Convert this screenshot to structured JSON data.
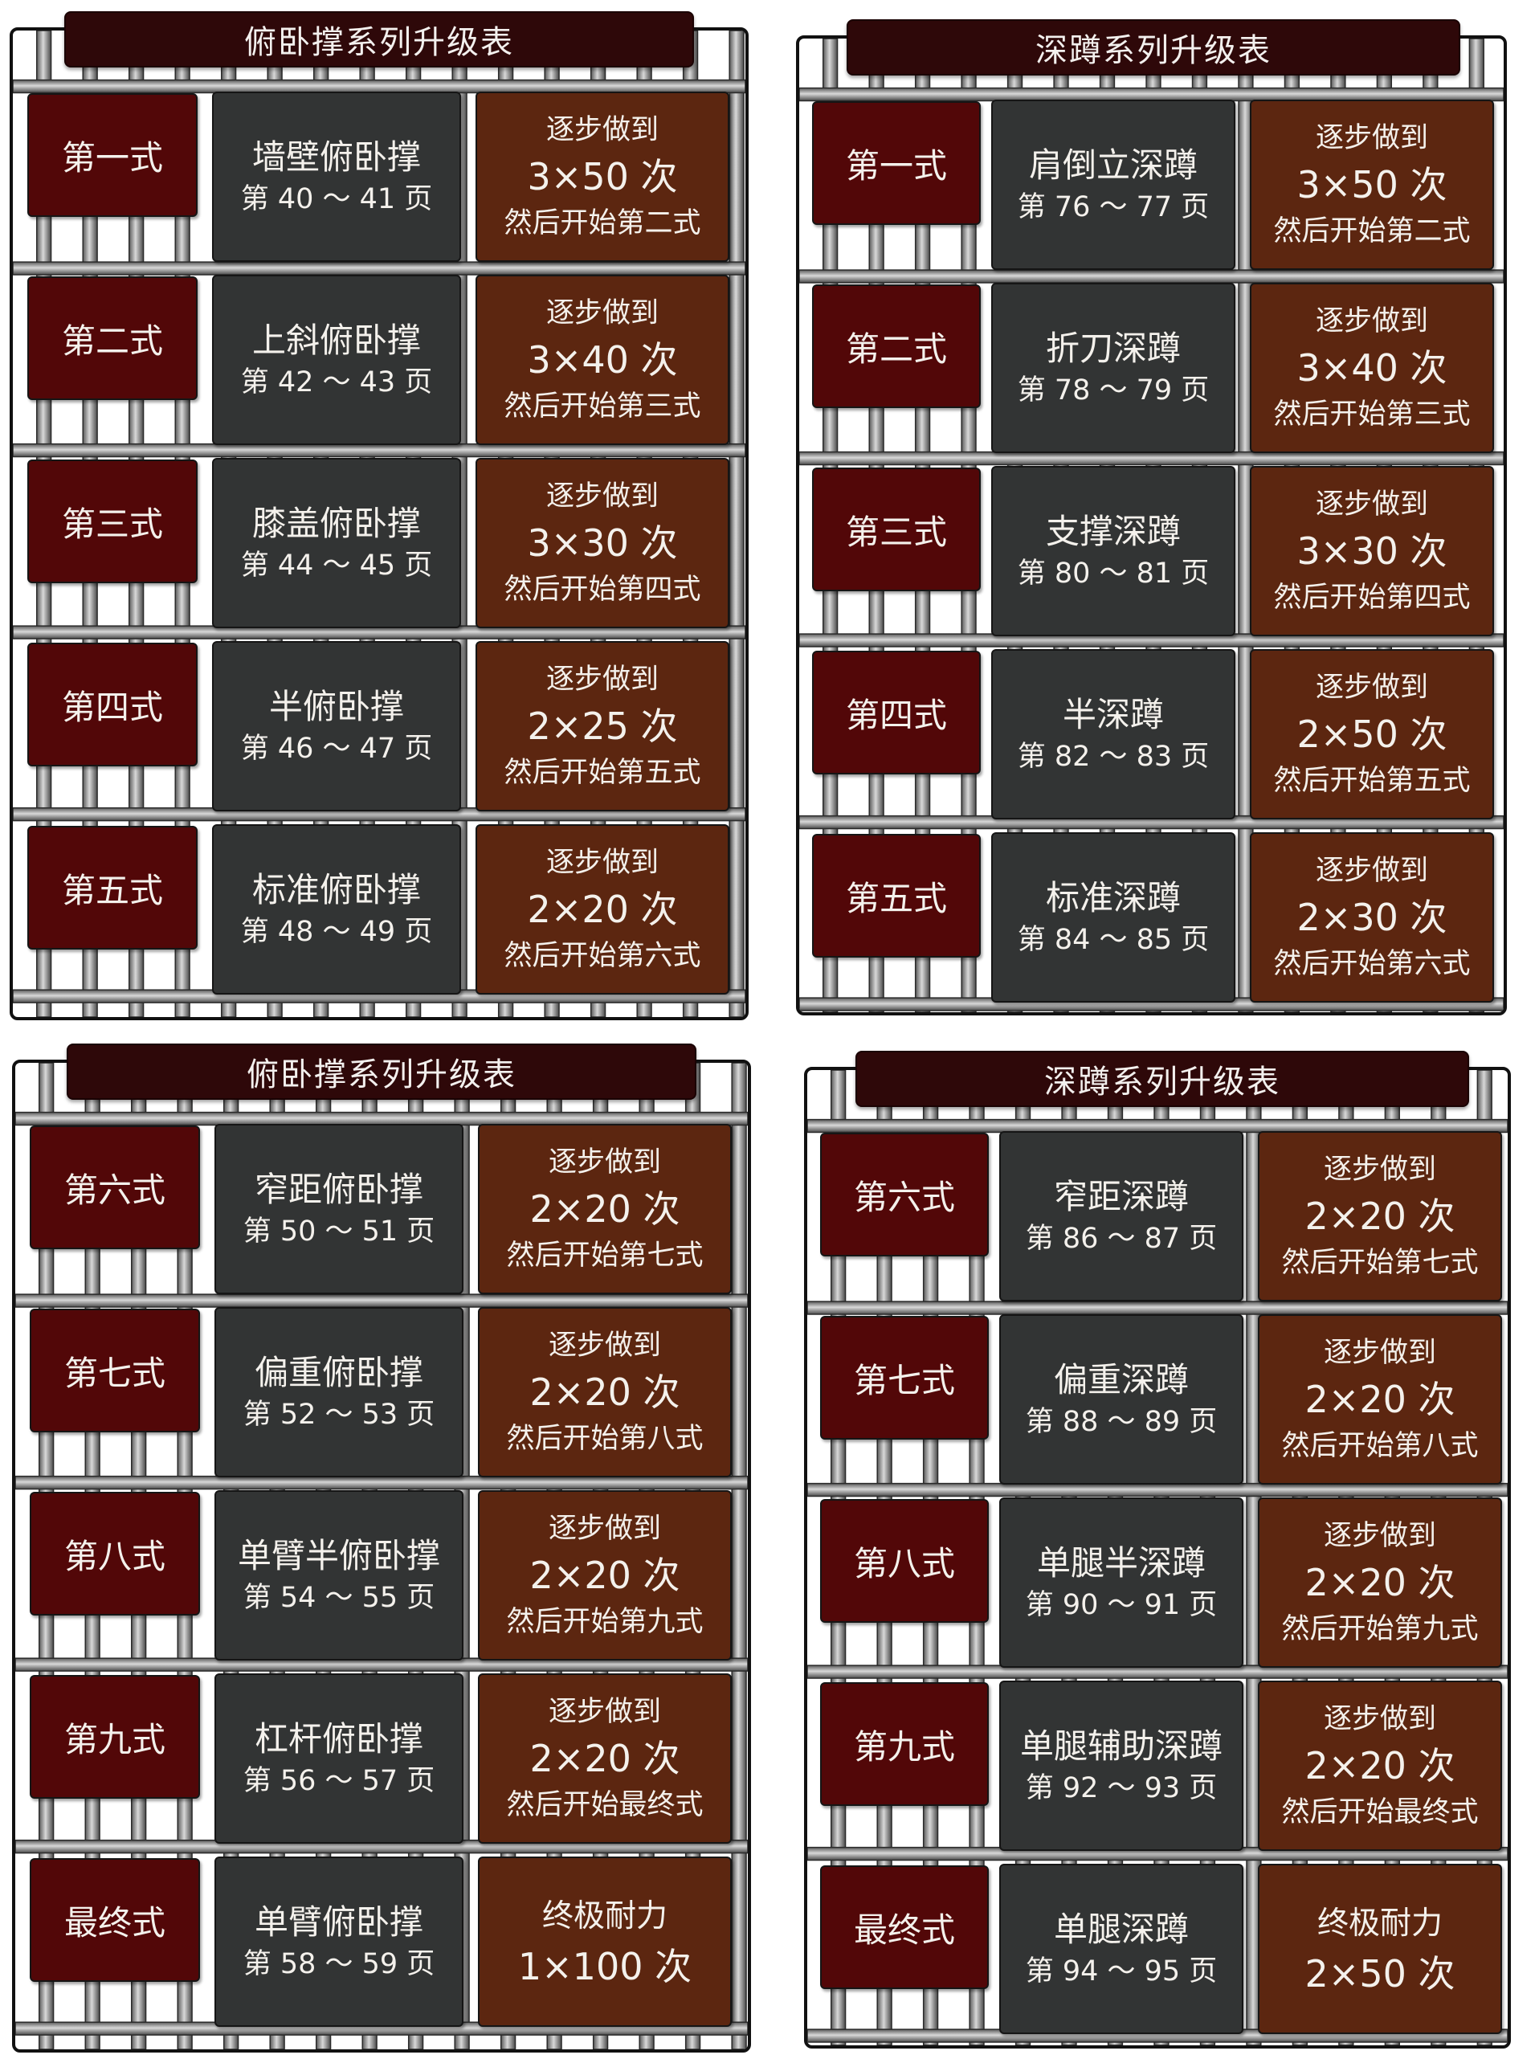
{
  "panels": [
    {
      "title": "俯卧撑系列升级表",
      "rows": [
        {
          "step": "第一式",
          "name": "墙壁俯卧撑",
          "pages": "第 40 ～ 41 页",
          "goal_top": "逐步做到",
          "goal_mid": "3×50 次",
          "goal_bot": "然后开始第二式"
        },
        {
          "step": "第二式",
          "name": "上斜俯卧撑",
          "pages": "第 42 ～ 43 页",
          "goal_top": "逐步做到",
          "goal_mid": "3×40 次",
          "goal_bot": "然后开始第三式"
        },
        {
          "step": "第三式",
          "name": "膝盖俯卧撑",
          "pages": "第 44 ～ 45 页",
          "goal_top": "逐步做到",
          "goal_mid": "3×30 次",
          "goal_bot": "然后开始第四式"
        },
        {
          "step": "第四式",
          "name": "半俯卧撑",
          "pages": "第 46 ～ 47 页",
          "goal_top": "逐步做到",
          "goal_mid": "2×25 次",
          "goal_bot": "然后开始第五式"
        },
        {
          "step": "第五式",
          "name": "标准俯卧撑",
          "pages": "第 48 ～ 49 页",
          "goal_top": "逐步做到",
          "goal_mid": "2×20 次",
          "goal_bot": "然后开始第六式"
        }
      ]
    },
    {
      "title": "深蹲系列升级表",
      "rows": [
        {
          "step": "第一式",
          "name": "肩倒立深蹲",
          "pages": "第 76 ～ 77 页",
          "goal_top": "逐步做到",
          "goal_mid": "3×50 次",
          "goal_bot": "然后开始第二式"
        },
        {
          "step": "第二式",
          "name": "折刀深蹲",
          "pages": "第 78 ～ 79 页",
          "goal_top": "逐步做到",
          "goal_mid": "3×40 次",
          "goal_bot": "然后开始第三式"
        },
        {
          "step": "第三式",
          "name": "支撑深蹲",
          "pages": "第 80 ～ 81 页",
          "goal_top": "逐步做到",
          "goal_mid": "3×30 次",
          "goal_bot": "然后开始第四式"
        },
        {
          "step": "第四式",
          "name": "半深蹲",
          "pages": "第 82 ～ 83 页",
          "goal_top": "逐步做到",
          "goal_mid": "2×50 次",
          "goal_bot": "然后开始第五式"
        },
        {
          "step": "第五式",
          "name": "标准深蹲",
          "pages": "第 84 ～ 85 页",
          "goal_top": "逐步做到",
          "goal_mid": "2×30 次",
          "goal_bot": "然后开始第六式"
        }
      ]
    },
    {
      "title": "俯卧撑系列升级表",
      "rows": [
        {
          "step": "第六式",
          "name": "窄距俯卧撑",
          "pages": "第 50 ～ 51 页",
          "goal_top": "逐步做到",
          "goal_mid": "2×20 次",
          "goal_bot": "然后开始第七式"
        },
        {
          "step": "第七式",
          "name": "偏重俯卧撑",
          "pages": "第 52 ～ 53 页",
          "goal_top": "逐步做到",
          "goal_mid": "2×20 次",
          "goal_bot": "然后开始第八式"
        },
        {
          "step": "第八式",
          "name": "单臂半俯卧撑",
          "pages": "第 54 ～ 55 页",
          "goal_top": "逐步做到",
          "goal_mid": "2×20 次",
          "goal_bot": "然后开始第九式"
        },
        {
          "step": "第九式",
          "name": "杠杆俯卧撑",
          "pages": "第 56 ～ 57 页",
          "goal_top": "逐步做到",
          "goal_mid": "2×20 次",
          "goal_bot": "然后开始最终式"
        },
        {
          "step": "最终式",
          "name": "单臂俯卧撑",
          "pages": "第 58 ～ 59 页",
          "goal_top": "终极耐力",
          "goal_mid": "1×100 次",
          "goal_bot": ""
        }
      ]
    },
    {
      "title": "深蹲系列升级表",
      "rows": [
        {
          "step": "第六式",
          "name": "窄距深蹲",
          "pages": "第 86 ～ 87 页",
          "goal_top": "逐步做到",
          "goal_mid": "2×20 次",
          "goal_bot": "然后开始第七式"
        },
        {
          "step": "第七式",
          "name": "偏重深蹲",
          "pages": "第 88 ～ 89 页",
          "goal_top": "逐步做到",
          "goal_mid": "2×20 次",
          "goal_bot": "然后开始第八式"
        },
        {
          "step": "第八式",
          "name": "单腿半深蹲",
          "pages": "第 90 ～ 91 页",
          "goal_top": "逐步做到",
          "goal_mid": "2×20 次",
          "goal_bot": "然后开始第九式"
        },
        {
          "step": "第九式",
          "name": "单腿辅助深蹲",
          "pages": "第 92 ～ 93 页",
          "goal_top": "逐步做到",
          "goal_mid": "2×20 次",
          "goal_bot": "然后开始最终式"
        },
        {
          "step": "最终式",
          "name": "单腿深蹲",
          "pages": "第 94 ～ 95 页",
          "goal_top": "终极耐力",
          "goal_mid": "2×50 次",
          "goal_bot": ""
        }
      ]
    }
  ],
  "colors": {
    "step_card": "#520708",
    "exercise_card": "#323434",
    "goal_card": "#5c2610",
    "banner": "#2e0809",
    "cage_bar": "#9a9a9a"
  }
}
